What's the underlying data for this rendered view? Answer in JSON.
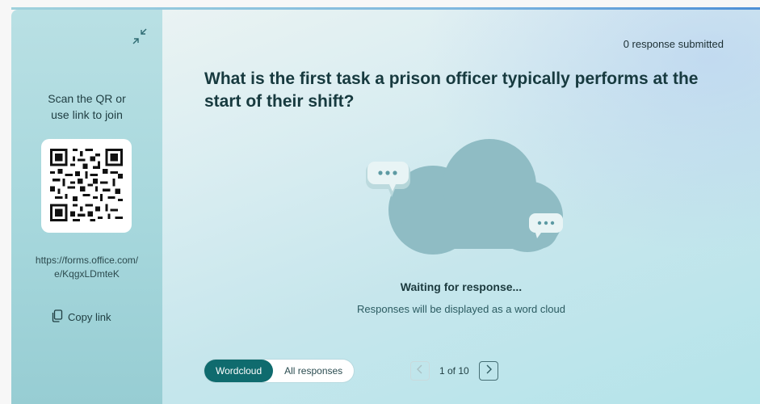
{
  "sidebar": {
    "join_instruction": "Scan the QR or use link to join",
    "join_link": "https://forms.office.com/e/KqgxLDmteK",
    "copy_link_label": "Copy link"
  },
  "header": {
    "response_count": "0 response submitted"
  },
  "question": {
    "text": "What is the first task a prison officer typically performs at the start of their shift?"
  },
  "status": {
    "title": "Waiting for response...",
    "subtitle": "Responses will be displayed as a word cloud"
  },
  "view_toggle": {
    "options": [
      "Wordcloud",
      "All responses"
    ],
    "selected": "Wordcloud"
  },
  "pagination": {
    "label": "1 of 10",
    "current": 1,
    "total": 10
  },
  "icons": {
    "collapse": "collapse-icon",
    "copy": "copy-icon",
    "prev": "chevron-left-icon",
    "next": "chevron-right-icon"
  },
  "colors": {
    "accent": "#0f6b6e",
    "cloud": "#8fbcc4",
    "sidebar": "#a6d7dc"
  }
}
